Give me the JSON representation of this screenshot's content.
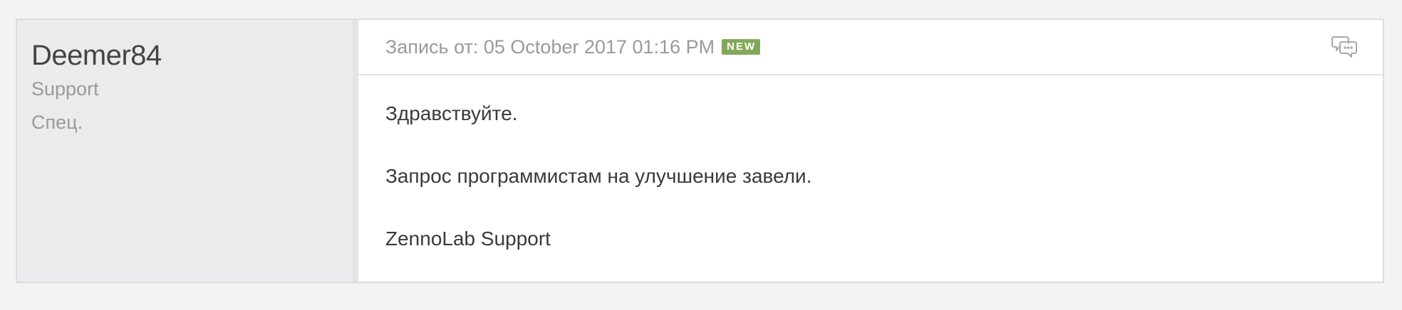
{
  "author": {
    "name": "Deemer84",
    "title": "Support",
    "rank": "Спец."
  },
  "post": {
    "date_label": "Запись от: 05 October 2017 01:16 PM",
    "badge": "NEW",
    "paragraphs": [
      "Здравствуйте.",
      "Запрос программистам на улучшение завели.",
      "ZennoLab Support"
    ],
    "icons": {
      "comment": "comment-bubbles-icon"
    }
  },
  "colors": {
    "badge": "#82a95a",
    "author_bg": "#ebebed",
    "page_bg": "#f3f3f3"
  }
}
